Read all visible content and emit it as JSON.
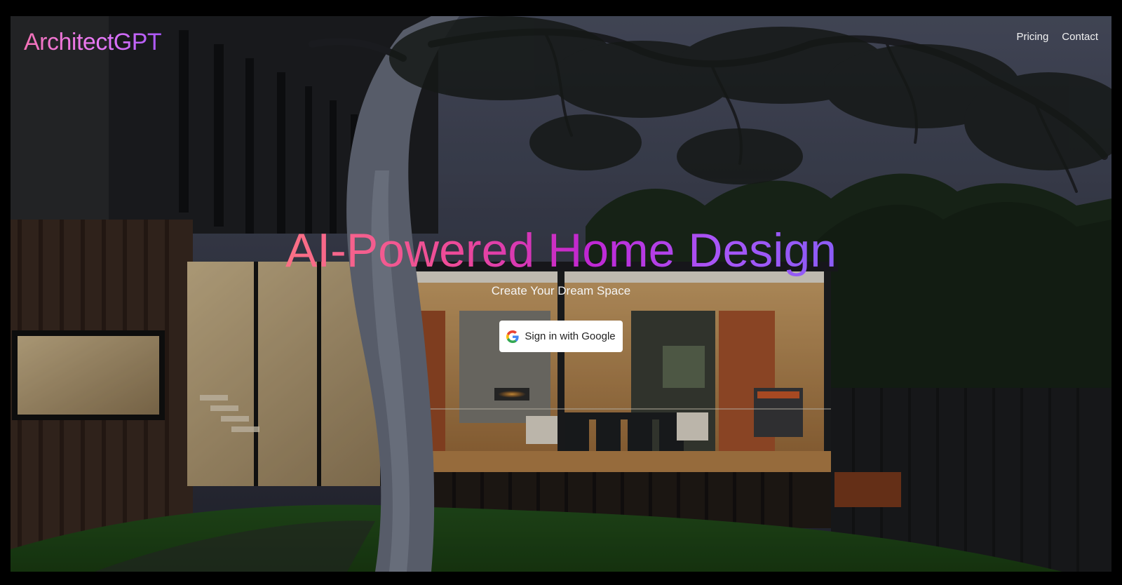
{
  "brand": {
    "name": "ArchitectGPT"
  },
  "nav": {
    "items": [
      {
        "label": "Pricing"
      },
      {
        "label": "Contact"
      }
    ]
  },
  "hero": {
    "headline": "AI-Powered Home Design",
    "subtitle": "Create Your Dream Space",
    "cta": {
      "label": "Sign in with Google",
      "icon": "google-g-icon"
    },
    "background_image": "modern-house-at-dusk-with-eucalyptus-tree"
  },
  "colors": {
    "page_background": "#000000",
    "brand_gradient": [
      "#f472b6",
      "#e879f9",
      "#a855f7"
    ],
    "headline_gradient": [
      "#fb7185",
      "#ec4899",
      "#c026d3",
      "#a855f7",
      "#8b5cf6"
    ],
    "button_background": "#ffffff",
    "button_text": "#222222",
    "nav_text": "#f2f2f2"
  }
}
